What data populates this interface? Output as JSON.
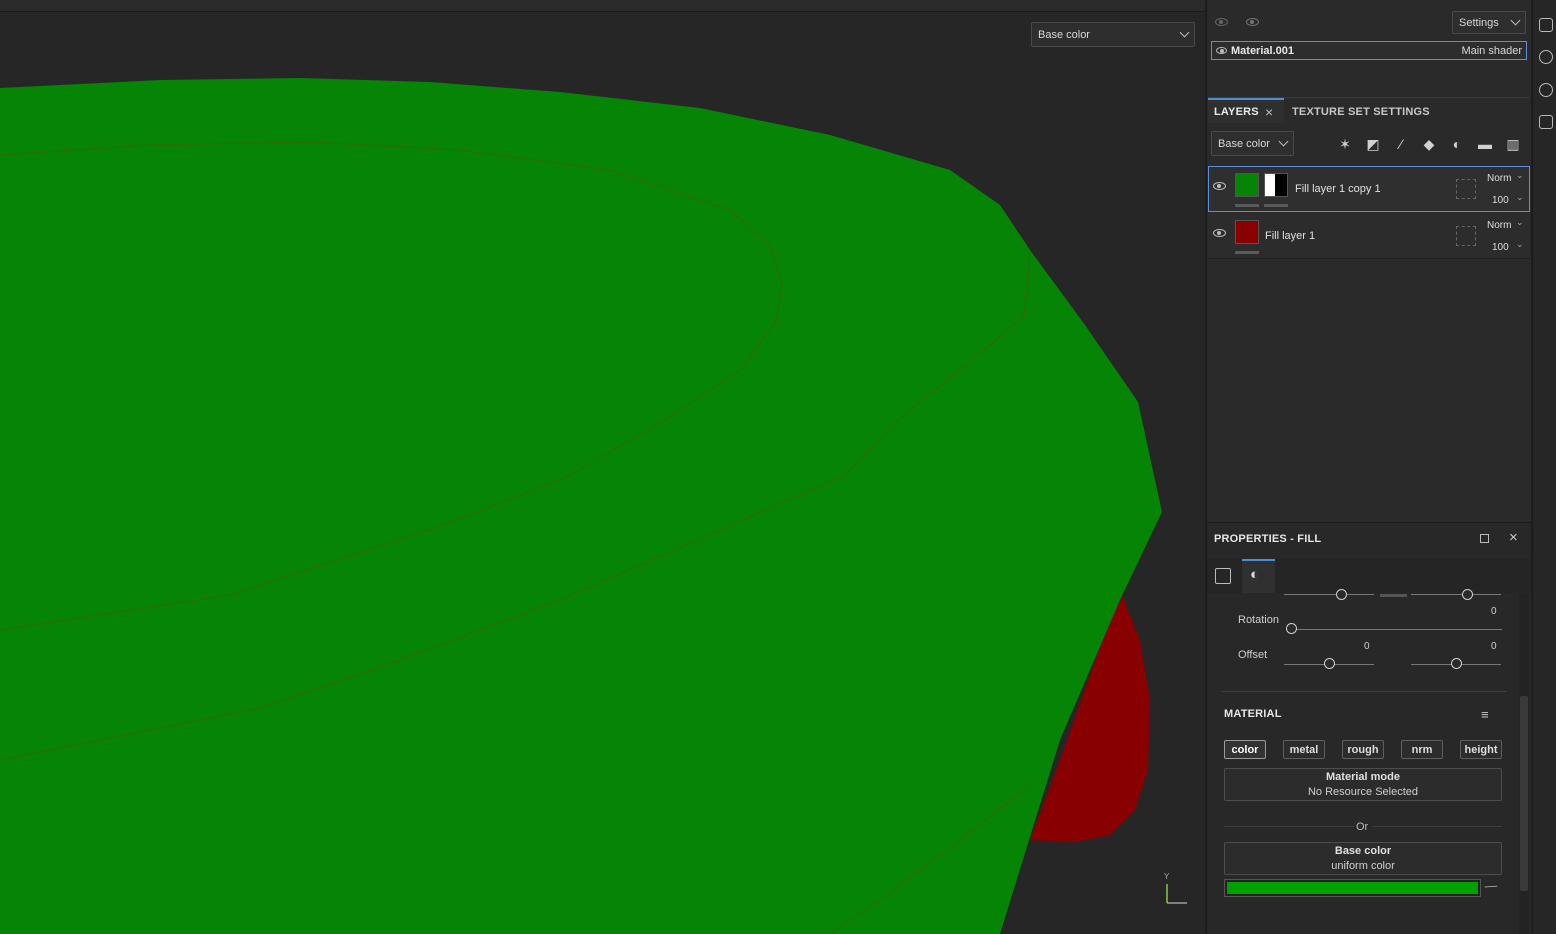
{
  "viewport": {
    "channel_dropdown": "Base color",
    "axis_label": "Y",
    "colors": {
      "green_surface": "#058405",
      "red_surface": "#880000",
      "background": "#262626"
    }
  },
  "texture_set": {
    "settings_dropdown": "Settings",
    "material_name": "Material.001",
    "shader_name": "Main shader"
  },
  "layers_panel": {
    "tabs": [
      {
        "label": "LAYERS"
      },
      {
        "label": "TEXTURE SET SETTINGS"
      }
    ],
    "channel_dropdown": "Base color",
    "toolbar_icons": [
      "magic-wand-icon",
      "mask-icon",
      "paint-brush-icon",
      "fill-bucket-icon",
      "smart-material-icon",
      "folder-icon",
      "trash-icon"
    ],
    "layers": [
      {
        "name": "Fill layer 1 copy 1",
        "blend": "Norm",
        "opacity": "100",
        "color": "#058405",
        "selected": true
      },
      {
        "name": "Fill layer 1",
        "blend": "Norm",
        "opacity": "100",
        "color": "#880000",
        "selected": false
      }
    ]
  },
  "properties": {
    "title": "PROPERTIES - FILL",
    "top_slider_value": "0",
    "rotation": {
      "label": "Rotation",
      "value": "0"
    },
    "offset": {
      "label": "Offset",
      "value_u": "0",
      "value_v": "0"
    },
    "material_section": {
      "title": "MATERIAL",
      "channels": [
        "color",
        "metal",
        "rough",
        "nrm",
        "height"
      ],
      "active_channel": "color",
      "material_mode": {
        "title": "Material mode",
        "subtitle": "No Resource Selected"
      },
      "or_label": "Or",
      "base_color": {
        "title": "Base color",
        "subtitle": "uniform color",
        "value": "#00a000"
      }
    }
  }
}
